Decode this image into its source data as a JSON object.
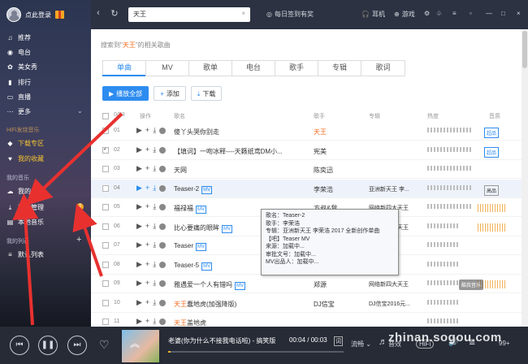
{
  "sidebar": {
    "login": "点此登录",
    "items": [
      {
        "icon": "thumb-icon",
        "label": "推荐",
        "glyph": "♫"
      },
      {
        "icon": "radio-icon",
        "label": "电台",
        "glyph": "◉"
      },
      {
        "icon": "star-icon",
        "label": "美女秀",
        "glyph": "✿"
      },
      {
        "icon": "chart-icon",
        "label": "排行",
        "glyph": "▮"
      },
      {
        "icon": "tv-icon",
        "label": "直播",
        "glyph": "▭"
      },
      {
        "icon": "more-icon",
        "label": "更多",
        "glyph": "⋯"
      }
    ],
    "hifi_section": "HiFi发烧音乐",
    "hifi_items": [
      "下载专区",
      "我的收藏"
    ],
    "my_music": "我的音乐",
    "my_items": [
      {
        "icon": "cloud-icon",
        "label": "我的电台"
      },
      {
        "icon": "download-icon",
        "label": "下载管理",
        "badge": "2"
      },
      {
        "icon": "folder-icon",
        "label": "本地音乐"
      }
    ],
    "my_lists": "我的列表",
    "default_list": "默认列表"
  },
  "topbar": {
    "search_value": "天王",
    "checkin": "每日签到有奖",
    "earphone": "耳机",
    "game": "游戏"
  },
  "main": {
    "result_prefix": "搜索到\"",
    "result_keyword": "天王",
    "result_suffix": "\"的相关歌曲",
    "tabs": [
      "单曲",
      "MV",
      "歌单",
      "电台",
      "歌手",
      "专辑",
      "歌词"
    ],
    "buttons": {
      "play_all": "播放全部",
      "add": "添加",
      "download": "下载"
    },
    "headers": {
      "count": "0/53",
      "op": "操作",
      "song": "歌名",
      "artist": "歌手",
      "album": "专辑",
      "heat": "热度",
      "quality": "音质"
    },
    "rows": [
      {
        "num": "01",
        "checked": true,
        "title": "傻丫头哭你别走",
        "title_kw": "",
        "mv": false,
        "artist": "天王",
        "artist_kw": true,
        "album": "",
        "quality": "超品"
      },
      {
        "num": "02",
        "checked": true,
        "title": "【填词】一吻冰释----天籁纸鸢DM小...",
        "title_kw": "",
        "mv": false,
        "artist": "宪美",
        "artist_kw": false,
        "album": "",
        "quality": "超品"
      },
      {
        "num": "03",
        "checked": false,
        "title": "天网",
        "title_kw": "",
        "mv": false,
        "artist": "陈奕迅",
        "artist_kw": false,
        "album": "",
        "quality": ""
      },
      {
        "num": "04",
        "checked": false,
        "title": "Teaser-2",
        "title_kw": "",
        "mv": true,
        "artist": "李荣浩",
        "artist_kw": false,
        "album": "亚洲新天王 李...",
        "quality": "高品"
      },
      {
        "num": "05",
        "checked": false,
        "title": "福禄福",
        "title_kw": "",
        "mv": true,
        "artist": "方叔&我...",
        "artist_kw": false,
        "album": "网络新四大天王",
        "quality": ""
      },
      {
        "num": "06",
        "checked": false,
        "title": "比心要痛的眼眸",
        "title_kw": "",
        "mv": true,
        "artist": "郑源",
        "artist_kw": false,
        "album": "网络新四大天王",
        "quality": ""
      },
      {
        "num": "07",
        "checked": false,
        "title": "Teaser",
        "title_kw": "",
        "mv": true,
        "artist": "",
        "artist_kw": false,
        "album": "",
        "quality": ""
      },
      {
        "num": "08",
        "checked": false,
        "title": "Teaser-5",
        "title_kw": "",
        "mv": true,
        "artist": "",
        "artist_kw": false,
        "album": "",
        "quality": ""
      },
      {
        "num": "09",
        "checked": false,
        "title": "雅遇爱一个人有错吗",
        "title_kw": "",
        "mv": true,
        "artist": "郑源",
        "artist_kw": false,
        "album": "网络新四大天王",
        "quality": ""
      },
      {
        "num": "10",
        "checked": false,
        "title": "蠢地虎(加强降版)",
        "title_kw": "天王",
        "mv": false,
        "artist": "DJ信宝",
        "artist_kw": false,
        "album": "DJ信宝2016元...",
        "quality": ""
      },
      {
        "num": "11",
        "checked": false,
        "title": "盖地虎",
        "title_kw": "天王",
        "mv": false,
        "artist": "",
        "artist_kw": false,
        "album": "",
        "quality": ""
      }
    ]
  },
  "tooltip": [
    "歌名：Teaser-2",
    "歌手：李荣浩",
    "专辑：亚洲新天王 李荣浩 2017 全新创作单曲",
    "【吧】Teaser MV",
    "来源：加载中...",
    "审批文号：加载中...",
    "MV出品人：加载中..."
  ],
  "player": {
    "song": "老婆(你为什么不接我电话啦) - 搞笑版",
    "time": "00:04 / 00:03",
    "lyric_btn": "词",
    "fluency": "流畅",
    "effect": "音效",
    "hifi": "HiFi",
    "count": "99+",
    "progress": 0.015
  },
  "watermarks": {
    "brand": "zhinan.sogou.com",
    "small": "酷我音乐"
  },
  "colors": {
    "accent": "#2d8cf0",
    "keyword": "#f26b1d",
    "arrow": "#e8312f"
  }
}
